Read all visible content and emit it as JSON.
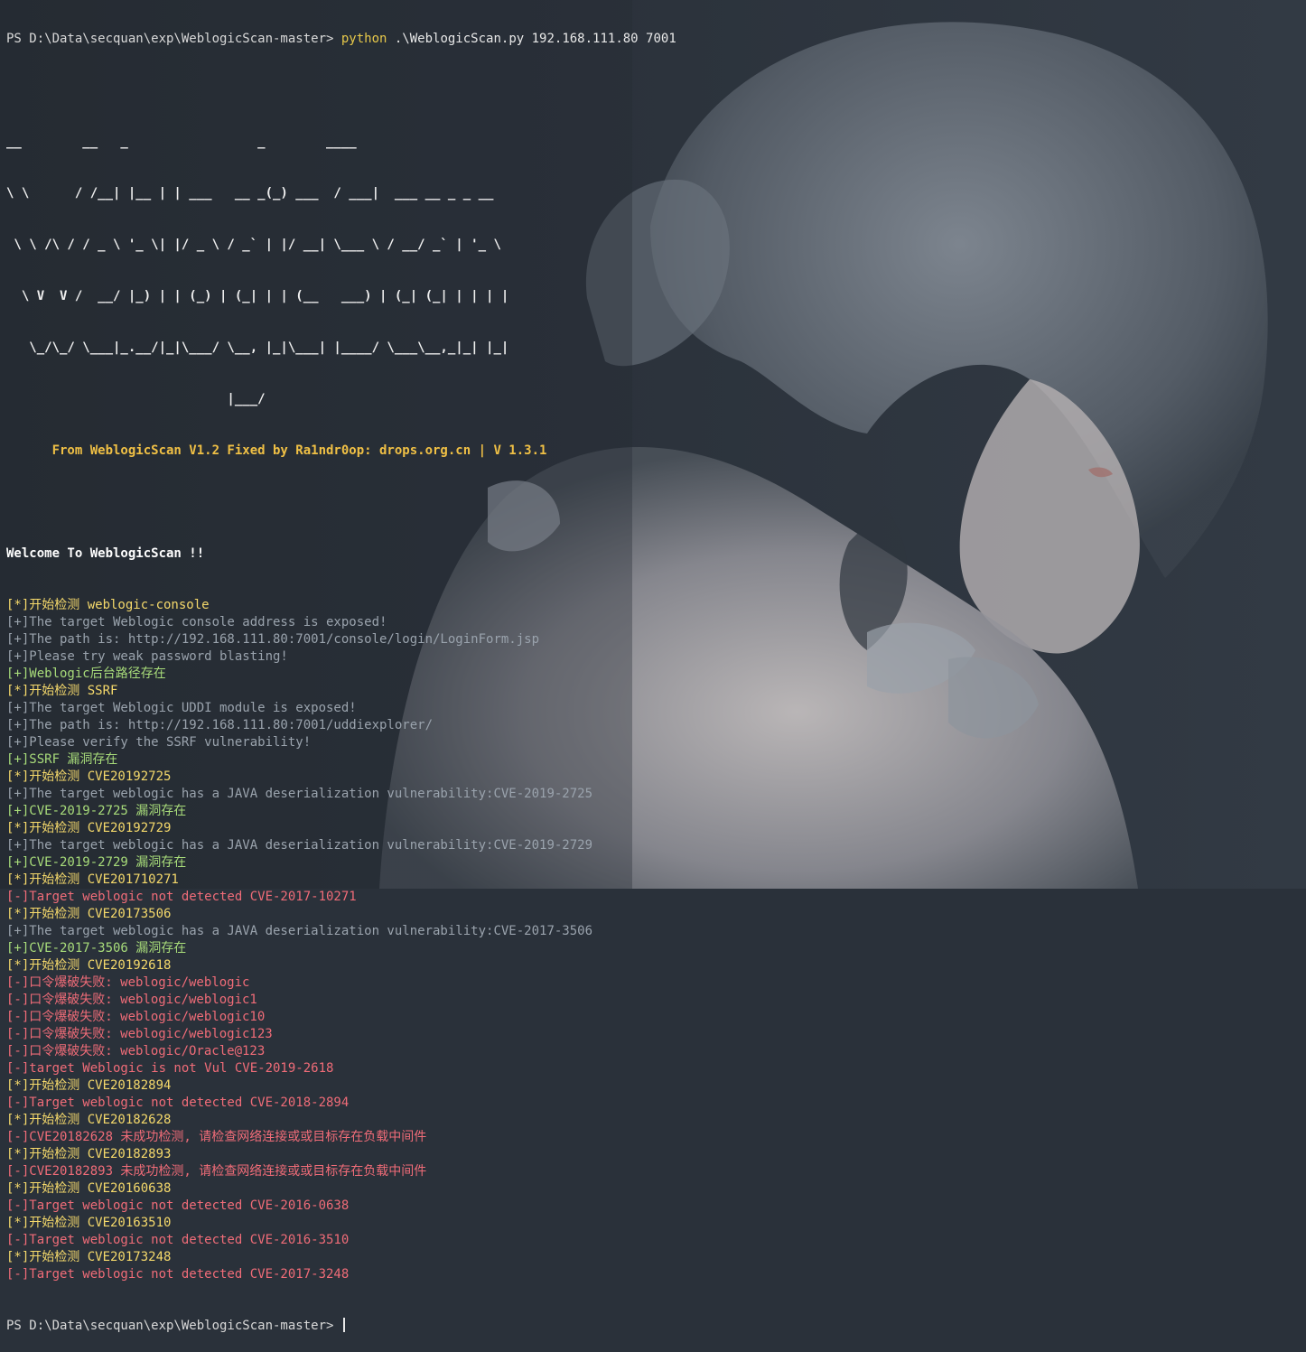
{
  "terminal": {
    "prompt": "PS D:\\Data\\secquan\\exp\\WeblogicScan-master> ",
    "command_program": "python",
    "command_args": " .\\WeblogicScan.py 192.168.111.80 7001",
    "banner": [
      "__        __   _                 _        ____",
      "\\ \\      / /__| |__ | | ___   __ _(_) ___  / ___|  ___ __ _ _ __",
      " \\ \\ /\\ / / _ \\ '_ \\| |/ _ \\ / _` | |/ __| \\___ \\ / __/ _` | '_ \\",
      "  \\ V  V /  __/ |_) | | (_) | (_| | | (__   ___) | (_| (_| | | | |",
      "   \\_/\\_/ \\___|_.__/|_|\\___/ \\__, |_|\\___| |____/ \\___\\__,_|_| |_|",
      "                             |___/"
    ],
    "subtitle": "      From WeblogicScan V1.2 Fixed by Ra1ndr0op: drops.org.cn | V 1.3.1",
    "welcome": "Welcome To WeblogicScan !!",
    "output": [
      {
        "type": "star",
        "text": "[*]开始检测 weblogic-console"
      },
      {
        "type": "info",
        "text": "[+]The target Weblogic console address is exposed!"
      },
      {
        "type": "info",
        "text": "[+]The path is: http://192.168.111.80:7001/console/login/LoginForm.jsp"
      },
      {
        "type": "info",
        "text": "[+]Please try weak password blasting!"
      },
      {
        "type": "ok",
        "text": "[+]Weblogic后台路径存在"
      },
      {
        "type": "star",
        "text": "[*]开始检测 SSRF"
      },
      {
        "type": "info",
        "text": "[+]The target Weblogic UDDI module is exposed!"
      },
      {
        "type": "info",
        "text": "[+]The path is: http://192.168.111.80:7001/uddiexplorer/"
      },
      {
        "type": "info",
        "text": "[+]Please verify the SSRF vulnerability!"
      },
      {
        "type": "ok",
        "text": "[+]SSRF 漏洞存在"
      },
      {
        "type": "star",
        "text": "[*]开始检测 CVE20192725"
      },
      {
        "type": "info",
        "text": "[+]The target weblogic has a JAVA deserialization vulnerability:CVE-2019-2725"
      },
      {
        "type": "ok",
        "text": "[+]CVE-2019-2725 漏洞存在"
      },
      {
        "type": "star",
        "text": "[*]开始检测 CVE20192729"
      },
      {
        "type": "info",
        "text": "[+]The target weblogic has a JAVA deserialization vulnerability:CVE-2019-2729"
      },
      {
        "type": "ok",
        "text": "[+]CVE-2019-2729 漏洞存在"
      },
      {
        "type": "star",
        "text": "[*]开始检测 CVE201710271"
      },
      {
        "type": "err",
        "text": "[-]Target weblogic not detected CVE-2017-10271"
      },
      {
        "type": "star",
        "text": "[*]开始检测 CVE20173506"
      },
      {
        "type": "info",
        "text": "[+]The target weblogic has a JAVA deserialization vulnerability:CVE-2017-3506"
      },
      {
        "type": "ok",
        "text": "[+]CVE-2017-3506 漏洞存在"
      },
      {
        "type": "star",
        "text": "[*]开始检测 CVE20192618"
      },
      {
        "type": "err",
        "text": "[-]口令爆破失败: weblogic/weblogic"
      },
      {
        "type": "err",
        "text": "[-]口令爆破失败: weblogic/weblogic1"
      },
      {
        "type": "err",
        "text": "[-]口令爆破失败: weblogic/weblogic10"
      },
      {
        "type": "err",
        "text": "[-]口令爆破失败: weblogic/weblogic123"
      },
      {
        "type": "err",
        "text": "[-]口令爆破失败: weblogic/Oracle@123"
      },
      {
        "type": "err",
        "text": "[-]target Weblogic is not Vul CVE-2019-2618"
      },
      {
        "type": "star",
        "text": "[*]开始检测 CVE20182894"
      },
      {
        "type": "err",
        "text": "[-]Target weblogic not detected CVE-2018-2894"
      },
      {
        "type": "star",
        "text": "[*]开始检测 CVE20182628"
      },
      {
        "type": "err",
        "text": "[-]CVE20182628 未成功检测, 请检查网络连接或或目标存在负载中间件"
      },
      {
        "type": "star",
        "text": "[*]开始检测 CVE20182893"
      },
      {
        "type": "err",
        "text": "[-]CVE20182893 未成功检测, 请检查网络连接或或目标存在负载中间件"
      },
      {
        "type": "star",
        "text": "[*]开始检测 CVE20160638"
      },
      {
        "type": "err",
        "text": "[-]Target weblogic not detected CVE-2016-0638"
      },
      {
        "type": "star",
        "text": "[*]开始检测 CVE20163510"
      },
      {
        "type": "err",
        "text": "[-]Target weblogic not detected CVE-2016-3510"
      },
      {
        "type": "star",
        "text": "[*]开始检测 CVE20173248"
      },
      {
        "type": "err",
        "text": "[-]Target weblogic not detected CVE-2017-3248"
      }
    ],
    "final_prompt": "PS D:\\Data\\secquan\\exp\\WeblogicScan-master> "
  },
  "colors": {
    "background": "#2a313a",
    "star": "#f5d96b",
    "info": "#9aa3ad",
    "ok": "#a8dc7a",
    "err": "#f06c78",
    "subtitle": "#f0c045"
  }
}
